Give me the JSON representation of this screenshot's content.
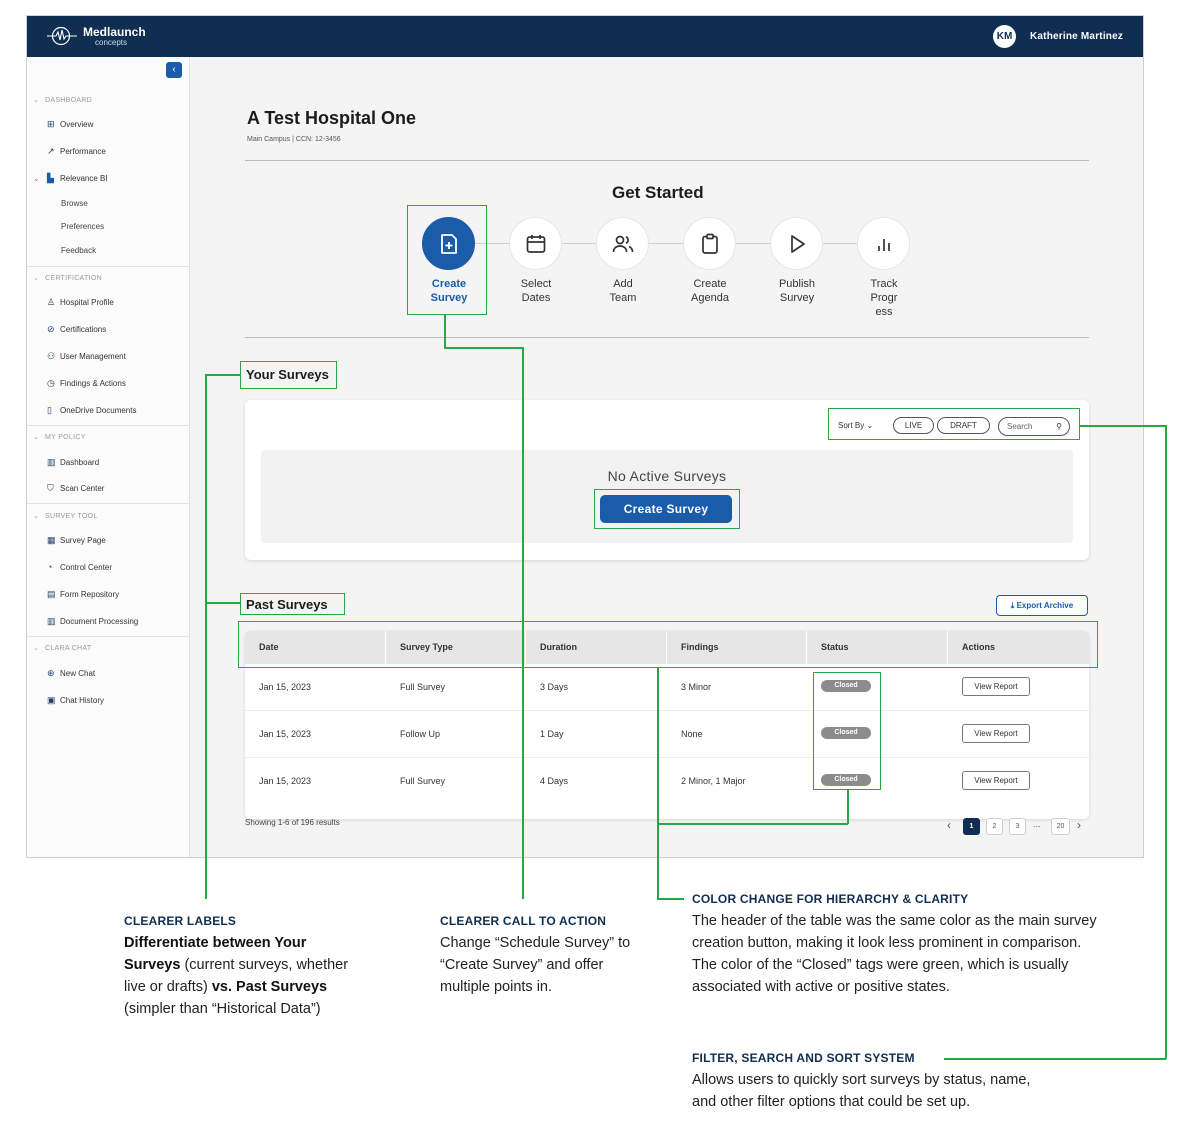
{
  "app": {
    "brand_name": "Medlaunch",
    "brand_sub": "concepts",
    "user_initials": "KM",
    "user_name": "Katherine Martinez"
  },
  "sidebar": {
    "sections": [
      {
        "title": "DASHBOARD",
        "items": [
          {
            "label": "Overview",
            "icon": "grid-icon"
          },
          {
            "label": "Performance",
            "icon": "trend-icon"
          },
          {
            "label": "Relevance BI",
            "icon": "bi-icon",
            "expanded": true
          },
          {
            "label": "Browse",
            "sub": true
          },
          {
            "label": "Preferences",
            "sub": true
          },
          {
            "label": "Feedback",
            "sub": true
          }
        ]
      },
      {
        "title": "CERTIFICATION",
        "items": [
          {
            "label": "Hospital Profile",
            "icon": "person-icon"
          },
          {
            "label": "Certifications",
            "icon": "check-circle-icon"
          },
          {
            "label": "User Management",
            "icon": "users-icon"
          },
          {
            "label": "Findings & Actions",
            "icon": "clock-icon"
          },
          {
            "label": "OneDrive Documents",
            "icon": "file-icon"
          }
        ]
      },
      {
        "title": "MY POLICY",
        "items": [
          {
            "label": "Dashboard",
            "icon": "chart-box-icon"
          },
          {
            "label": "Scan Center",
            "icon": "shield-check-icon"
          }
        ]
      },
      {
        "title": "SURVEY TOOL",
        "items": [
          {
            "label": "Survey Page",
            "icon": "calendar-icon"
          },
          {
            "label": "Control Center",
            "icon": "gauge-icon"
          },
          {
            "label": "Form Repository",
            "icon": "form-icon"
          },
          {
            "label": "Document Processing",
            "icon": "doc-chart-icon"
          }
        ]
      },
      {
        "title": "CLARA CHAT",
        "items": [
          {
            "label": "New Chat",
            "icon": "chat-plus-icon"
          },
          {
            "label": "Chat History",
            "icon": "history-icon"
          }
        ]
      }
    ]
  },
  "page": {
    "title": "A Test Hospital One",
    "subtitle": "Main Campus | CCN: 12-3456",
    "get_started": "Get Started",
    "steps": [
      {
        "line1": "Create",
        "line2": "Survey",
        "line3": "",
        "icon": "file-plus-icon",
        "active": true
      },
      {
        "line1": "Select",
        "line2": "Dates",
        "line3": "",
        "icon": "calendar-icon"
      },
      {
        "line1": "Add",
        "line2": "Team",
        "line3": "",
        "icon": "users-icon"
      },
      {
        "line1": "Create",
        "line2": "Agenda",
        "line3": "",
        "icon": "clipboard-icon"
      },
      {
        "line1": "Publish",
        "line2": "Survey",
        "line3": "",
        "icon": "play-icon"
      },
      {
        "line1": "Track",
        "line2": "Progr",
        "line3": "ess",
        "icon": "bars-icon"
      }
    ],
    "your_surveys": "Your Surveys",
    "sort_by": "Sort By",
    "filter_live": "LIVE",
    "filter_draft": "DRAFT",
    "search_placeholder": "Search",
    "no_active": "No Active Surveys",
    "create_survey_btn": "Create Survey",
    "past_surveys": "Past Surveys",
    "export_archive": "Export Archive",
    "table": {
      "headers": [
        "Date",
        "Survey Type",
        "Duration",
        "Findings",
        "Status",
        "Actions"
      ],
      "rows": [
        {
          "date": "Jan 15, 2023",
          "type": "Full Survey",
          "duration": "3 Days",
          "findings": "3 Minor",
          "status": "Closed",
          "action": "View Report"
        },
        {
          "date": "Jan 15, 2023",
          "type": "Follow Up",
          "duration": "1 Day",
          "findings": "None",
          "status": "Closed",
          "action": "View Report"
        },
        {
          "date": "Jan 15, 2023",
          "type": "Full Survey",
          "duration": "4 Days",
          "findings": "2 Minor, 1 Major",
          "status": "Closed",
          "action": "View Report"
        }
      ]
    },
    "showing": "Showing 1-6 of 196 results",
    "pagination": [
      "1",
      "2",
      "3",
      "...",
      "20"
    ]
  },
  "annotations": {
    "labels_head": "CLEARER LABELS",
    "labels_b1": "Differentiate between Your Surveys",
    "labels_t1": " (current surveys, whether live or drafts) ",
    "labels_b2": "vs. Past Surveys",
    "labels_t2": " (simpler than “Historical Data”)",
    "cta_head": "CLEARER CALL TO ACTION",
    "cta_body": "Change “Schedule Survey” to “Create Survey” and offer multiple points in.",
    "color_head": "COLOR CHANGE FOR HIERARCHY & CLARITY",
    "color_body1": "The header of the table was the same color as the main survey creation button, making it look less prominent in comparison.",
    "color_body2": "The color of the “Closed” tags were green, which is usually associated with active or positive states.",
    "filter_head": "FILTER, SEARCH AND SORT SYSTEM",
    "filter_body": "Allows users to quickly sort surveys by status, name, and other filter options that could be set up."
  },
  "colors": {
    "nav_dark": "#0f2e52",
    "primary_blue": "#1a5ca8",
    "annotation_green": "#28a745",
    "closed_tag": "#8c8c8c"
  }
}
